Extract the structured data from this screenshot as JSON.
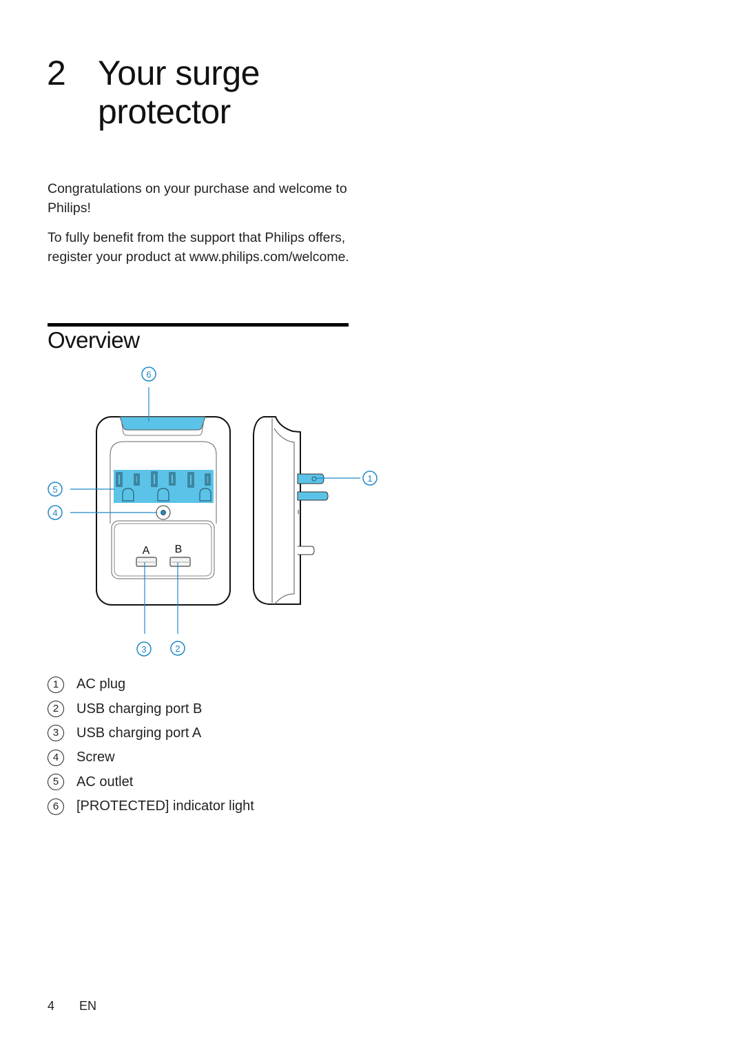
{
  "chapter": {
    "number": "2",
    "title": "Your surge protector"
  },
  "intro": {
    "paragraphs": [
      "Congratulations on your purchase and welcome to Philips!",
      "To fully benefit from the support that Philips offers, register your product at www.philips.com/welcome."
    ]
  },
  "section": {
    "title": "Overview"
  },
  "diagram": {
    "accent_color": "#5bc3e8",
    "callout_color": "#1e88c7",
    "port_labels": [
      "A",
      "B"
    ],
    "callouts": [
      "1",
      "2",
      "3",
      "4",
      "5",
      "6"
    ]
  },
  "legend": [
    {
      "num": "1",
      "label": "AC plug"
    },
    {
      "num": "2",
      "label": "USB charging port B"
    },
    {
      "num": "3",
      "label": "USB charging port A"
    },
    {
      "num": "4",
      "label": "Screw"
    },
    {
      "num": "5",
      "label": "AC outlet"
    },
    {
      "num": "6",
      "label": "[PROTECTED] indicator light"
    }
  ],
  "footer": {
    "page": "4",
    "language": "EN"
  }
}
